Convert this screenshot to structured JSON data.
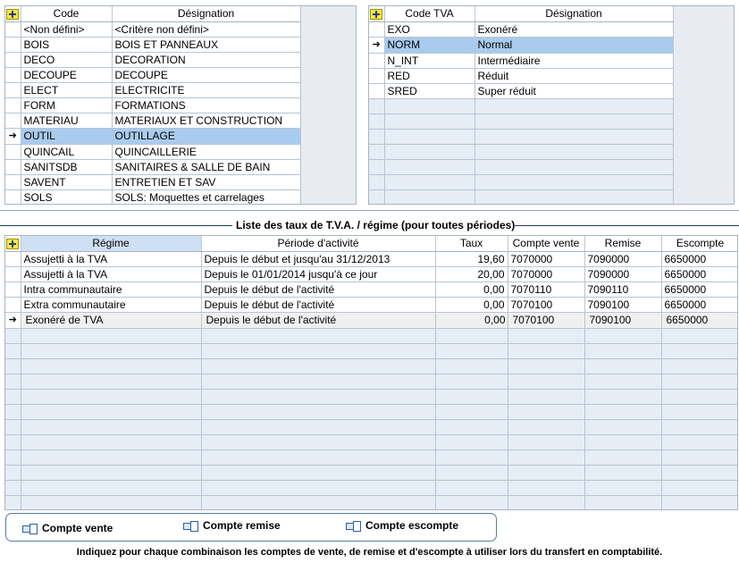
{
  "family_grid": {
    "headers": {
      "code": "Code",
      "designation": "Désignation"
    },
    "rows": [
      {
        "code": "<Non défini>",
        "designation": "<Critère non défini>"
      },
      {
        "code": "BOIS",
        "designation": "BOIS ET PANNEAUX"
      },
      {
        "code": "DECO",
        "designation": "DECORATION"
      },
      {
        "code": "DECOUPE",
        "designation": "DECOUPE"
      },
      {
        "code": "ELECT",
        "designation": "ELECTRICITE"
      },
      {
        "code": "FORM",
        "designation": "FORMATIONS"
      },
      {
        "code": "MATERIAU",
        "designation": "MATERIAUX ET CONSTRUCTION"
      },
      {
        "code": "OUTIL",
        "designation": "OUTILLAGE"
      },
      {
        "code": "QUINCAIL",
        "designation": "QUINCAILLERIE"
      },
      {
        "code": "SANITSDB",
        "designation": "SANITAIRES & SALLE DE BAIN"
      },
      {
        "code": "SAVENT",
        "designation": "ENTRETIEN ET SAV"
      },
      {
        "code": "SOLS",
        "designation": "SOLS: Moquettes et carrelages"
      }
    ]
  },
  "tva_grid": {
    "headers": {
      "code": "Code TVA",
      "designation": "Désignation"
    },
    "rows": [
      {
        "code": "EXO",
        "designation": "Exonéré"
      },
      {
        "code": "NORM",
        "designation": "Normal"
      },
      {
        "code": "N_INT",
        "designation": "Intermédiaire"
      },
      {
        "code": "RED",
        "designation": "Réduit"
      },
      {
        "code": "SRED",
        "designation": "Super réduit"
      }
    ]
  },
  "rates_section": {
    "title": "Liste des taux de T.V.A. / régime (pour toutes périodes)"
  },
  "rates_grid": {
    "headers": {
      "regime": "Régime",
      "periode": "Période d'activité",
      "taux": "Taux",
      "compte_vente": "Compte vente",
      "remise": "Remise",
      "escompte": "Escompte"
    },
    "rows": [
      {
        "regime": "Assujetti à la TVA",
        "periode": "Depuis le début et jusqu'au 31/12/2013",
        "taux": "19,60",
        "compte_vente": "7070000",
        "remise": "7090000",
        "escompte": "6650000"
      },
      {
        "regime": "Assujetti à la TVA",
        "periode": "Depuis le 01/01/2014 jusqu'à ce jour",
        "taux": "20,00",
        "compte_vente": "7070000",
        "remise": "7090000",
        "escompte": "6650000"
      },
      {
        "regime": "Intra communautaire",
        "periode": "Depuis le début de l'activité",
        "taux": "0,00",
        "compte_vente": "7070110",
        "remise": "7090110",
        "escompte": "6650000"
      },
      {
        "regime": "Extra communautaire",
        "periode": "Depuis le début de l'activité",
        "taux": "0,00",
        "compte_vente": "7070100",
        "remise": "7090100",
        "escompte": "6650000"
      },
      {
        "regime": "Exonéré de TVA",
        "periode": "Depuis le début de l'activité",
        "taux": "0,00",
        "compte_vente": "7070100",
        "remise": "7090100",
        "escompte": "6650000"
      }
    ]
  },
  "toolbar": {
    "compte_vente": "Compte vente",
    "compte_remise": "Compte remise",
    "compte_escompte": "Compte escompte"
  },
  "footer": {
    "text": "Indiquez pour chaque combinaison les comptes de vente, de remise et d'escompte à utiliser lors du transfert en comptabilité."
  },
  "icons": {
    "add": "plus-icon",
    "current_row": "arrow-right-icon",
    "link": "link-icon"
  },
  "colors": {
    "selection": "#a9cbee",
    "empty_row": "#e6edf5",
    "border": "#a8b4c4",
    "add_icon": "#f5ea3a"
  }
}
